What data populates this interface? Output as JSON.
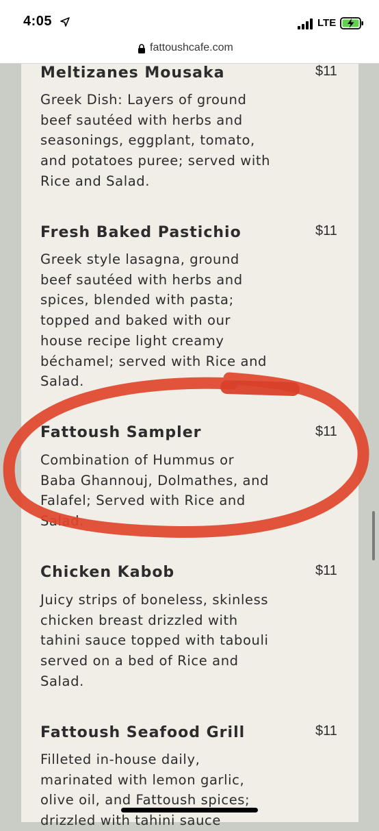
{
  "status_bar": {
    "time": "4:05",
    "network": "LTE",
    "icons": [
      "location-arrow-icon",
      "signal-icon",
      "battery-charging-icon"
    ]
  },
  "url_bar": {
    "url": "fattoushcafe.com",
    "icon": "lock-icon"
  },
  "menu": {
    "items": [
      {
        "name": "Meltizanes Mousaka",
        "price": "$11",
        "description_lines": [
          "Greek Dish: Layers of ground",
          "beef sautéed with herbs and",
          "seasonings, eggplant, tomato,",
          "and potatoes puree; served with",
          "Rice and Salad."
        ]
      },
      {
        "name": "Fresh Baked Pastichio",
        "price": "$11",
        "description_lines": [
          "Greek style lasagna, ground",
          "beef sautéed with herbs and",
          "spices, blended with pasta;",
          "topped and baked with our",
          "house recipe light creamy",
          "béchamel; served with Rice and",
          "Salad."
        ]
      },
      {
        "name": "Fattoush Sampler",
        "price": "$11",
        "description_lines": [
          "Combination of Hummus or",
          "Baba Ghannouj, Dolmathes, and",
          "Falafel; Served with Rice and",
          "Salad."
        ]
      },
      {
        "name": "Chicken Kabob",
        "price": "$11",
        "description_lines": [
          "Juicy strips of boneless, skinless",
          "chicken breast drizzled with",
          "tahini sauce topped with tabouli",
          "served on a bed of Rice and",
          "Salad."
        ]
      },
      {
        "name": "Fattoush Seafood Grill",
        "price": "$11",
        "description_lines": [
          "Filleted in-house daily,",
          "marinated with lemon garlic,",
          "olive oil, and Fattoush spices;",
          "drizzled with tahini sauce"
        ]
      }
    ]
  },
  "colors": {
    "background": "#c9cdc6",
    "panel": "#f1eee8",
    "text": "#2c2c2c",
    "highlight_circle": "#e0452a"
  }
}
